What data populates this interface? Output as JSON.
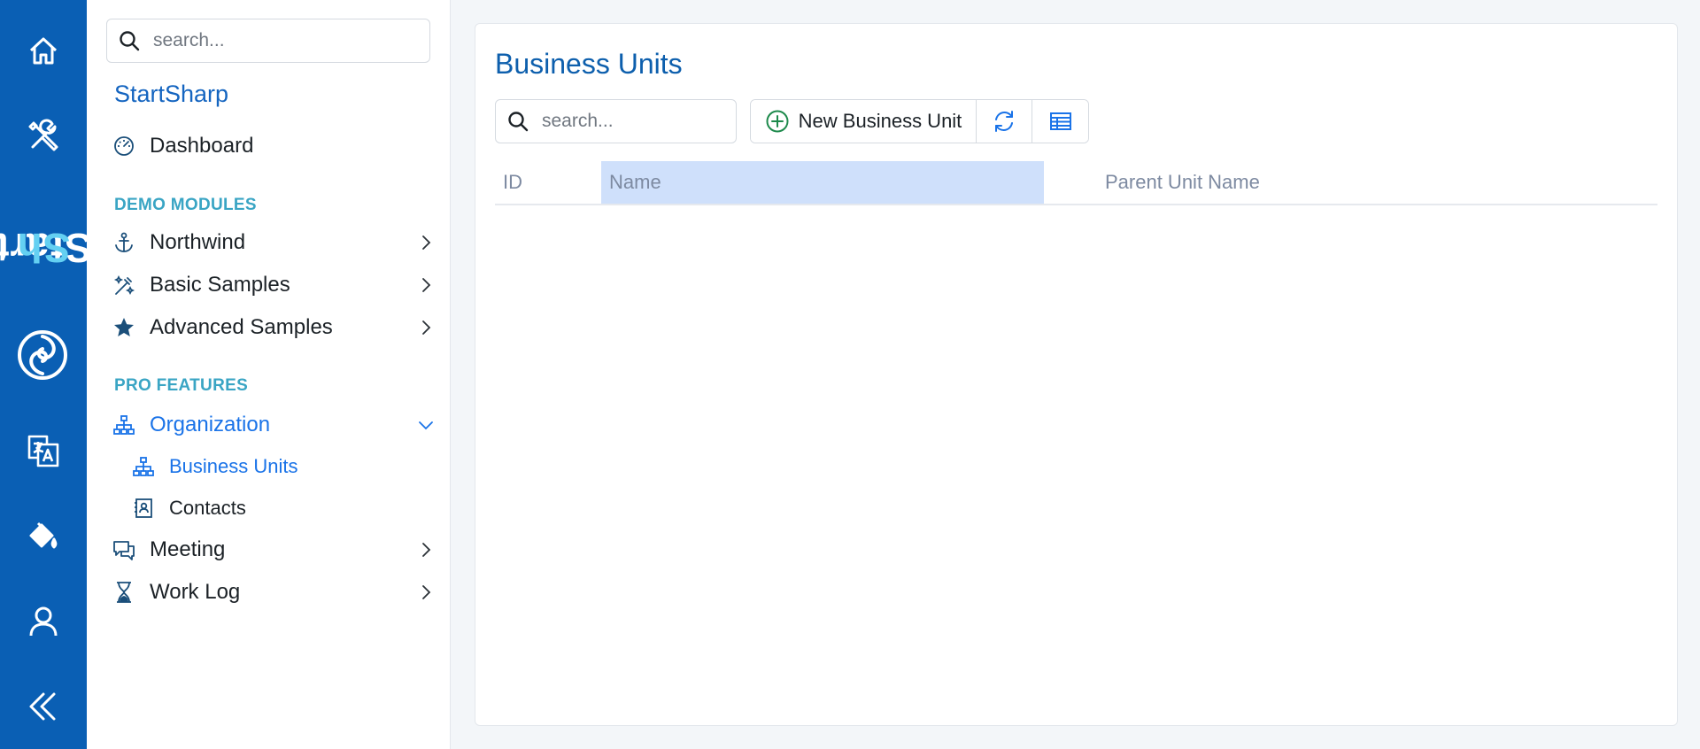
{
  "rail": {
    "brand_main": "Start",
    "brand_accent": "Sh",
    "icons": [
      "home-icon",
      "tools-icon",
      "translate-icon",
      "paint-bucket-icon",
      "user-icon",
      "collapse-icon"
    ]
  },
  "sidebar": {
    "search_placeholder": "search...",
    "app_title": "StartSharp",
    "dashboard": "Dashboard",
    "demo_modules_label": "DEMO MODULES",
    "demo_items": [
      {
        "label": "Northwind",
        "icon": "anchor-icon"
      },
      {
        "label": "Basic Samples",
        "icon": "magic-wand-icon"
      },
      {
        "label": "Advanced Samples",
        "icon": "star-icon"
      }
    ],
    "pro_features_label": "PRO FEATURES",
    "organization": "Organization",
    "org_children": [
      {
        "label": "Business Units",
        "icon": "org-chart-icon"
      },
      {
        "label": "Contacts",
        "icon": "contact-card-icon"
      }
    ],
    "pro_items": [
      {
        "label": "Meeting",
        "icon": "chat-bubbles-icon"
      },
      {
        "label": "Work Log",
        "icon": "hourglass-icon"
      }
    ]
  },
  "main": {
    "title": "Business Units",
    "search_placeholder": "search...",
    "new_button_label": "New Business Unit",
    "columns": [
      "ID",
      "Name",
      "Parent Unit Name"
    ],
    "rows": []
  },
  "colors": {
    "rail_bg": "#0a5fb4",
    "accent": "#1a73e8",
    "section_label": "#3aa5c4",
    "sorted_column_bg": "#cfe0fb"
  }
}
